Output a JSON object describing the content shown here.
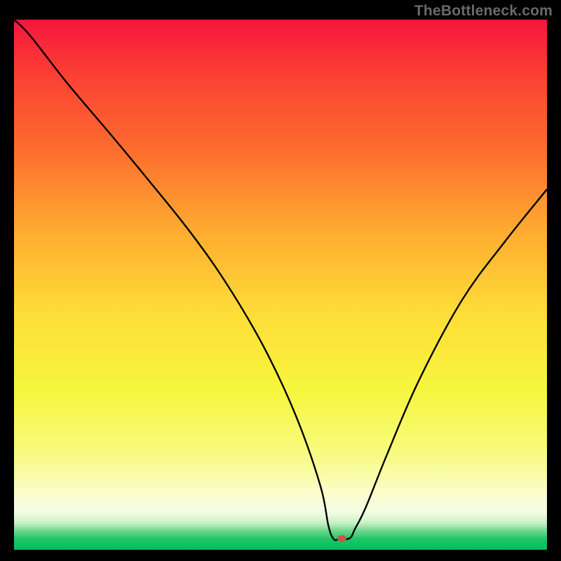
{
  "watermark": "TheBottleneck.com",
  "chart_data": {
    "type": "line",
    "title": "",
    "xlabel": "",
    "ylabel": "",
    "xlim": [
      0,
      100
    ],
    "ylim": [
      0,
      100
    ],
    "series": [
      {
        "name": "curve",
        "x": [
          0,
          3,
          10,
          18,
          25,
          33,
          40,
          47,
          53,
          57.5,
          59,
          60,
          61,
          63,
          64,
          66,
          70,
          76,
          84,
          92,
          100
        ],
        "y": [
          100,
          97,
          88,
          78.5,
          70,
          60,
          50,
          38,
          25,
          12,
          4.5,
          2,
          2,
          2.2,
          4,
          8,
          18,
          32,
          47,
          58,
          68
        ],
        "color": "#000000"
      }
    ],
    "marker": {
      "x": 61.5,
      "y": 2.1,
      "color": "#c05a4a"
    },
    "gradient_stops": [
      {
        "pct": 0,
        "color": "#f6153d"
      },
      {
        "pct": 11,
        "color": "#fb4233"
      },
      {
        "pct": 25,
        "color": "#fd6e2f"
      },
      {
        "pct": 40,
        "color": "#feac30"
      },
      {
        "pct": 55,
        "color": "#fedc38"
      },
      {
        "pct": 70,
        "color": "#f6f63e"
      },
      {
        "pct": 82,
        "color": "#f8fb81"
      },
      {
        "pct": 90,
        "color": "#fbfdd2"
      },
      {
        "pct": 93,
        "color": "#f4fce5"
      },
      {
        "pct": 95,
        "color": "#c6f0c2"
      },
      {
        "pct": 96.5,
        "color": "#6ad58a"
      },
      {
        "pct": 98,
        "color": "#1dc765"
      },
      {
        "pct": 100,
        "color": "#04bb62"
      }
    ]
  }
}
